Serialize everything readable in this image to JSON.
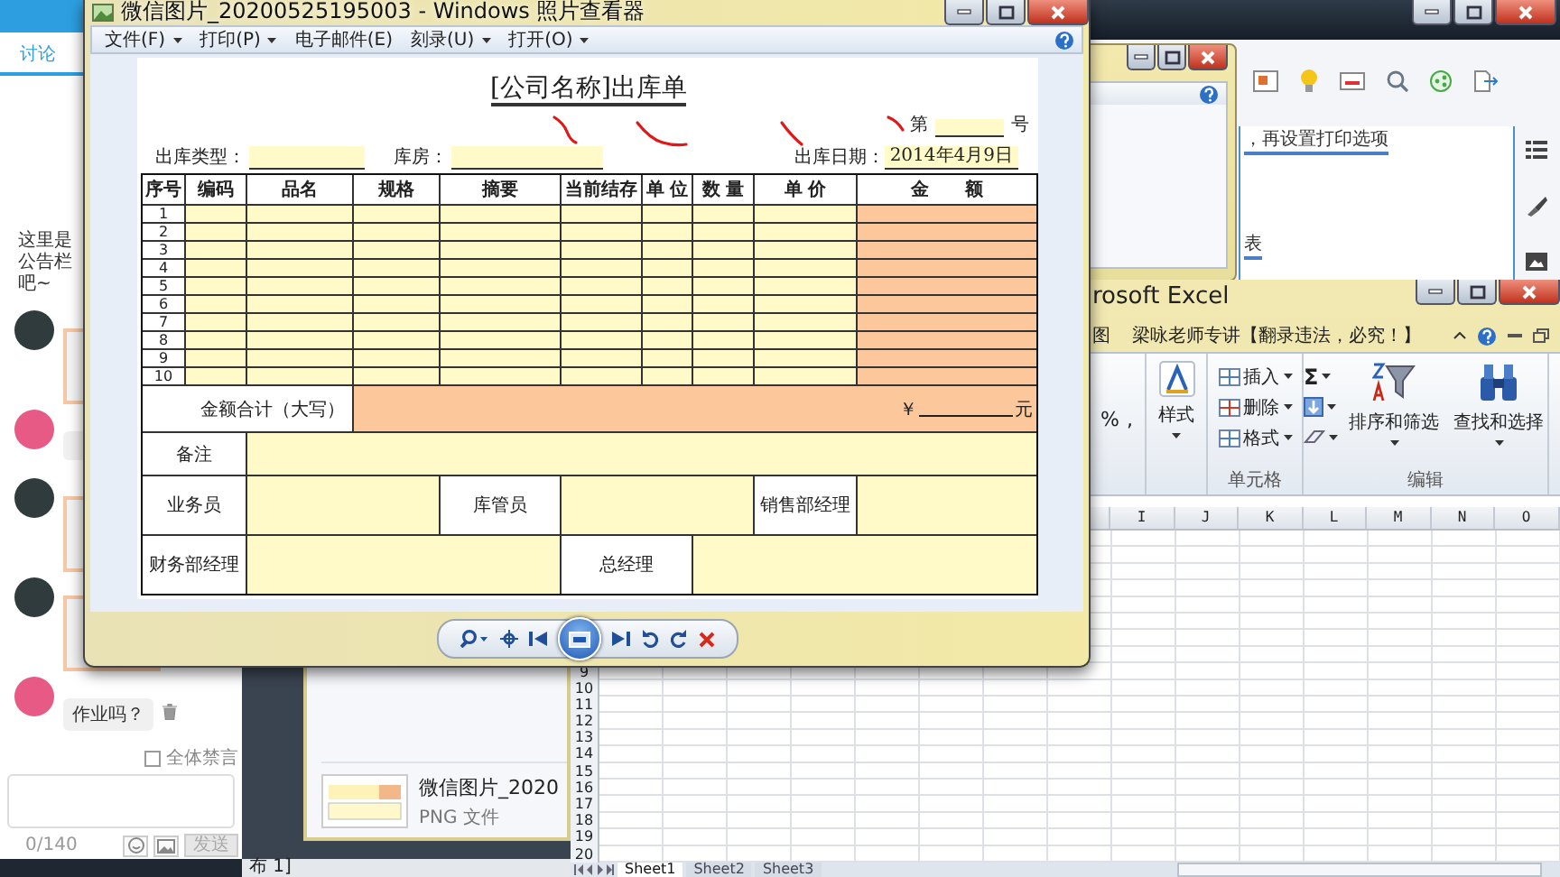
{
  "chat_panel": {
    "tab": {
      "label": "讨论",
      "selected": true
    },
    "notice": "这里是公告栏吧~",
    "messages": [
      {
        "kind": "image",
        "color": "#2f3b3c"
      },
      {
        "kind": "text",
        "color": "#e85a86"
      },
      {
        "kind": "image",
        "color": "#2f3b3c"
      },
      {
        "kind": "image",
        "color": "#2f3b3c"
      },
      {
        "kind": "text",
        "color": "#e85a86",
        "text": "作业吗？"
      }
    ],
    "mute_all": {
      "label": "全体禁言",
      "checked": false
    },
    "counter": "0/140",
    "send_button": {
      "label": "发送",
      "disabled": true
    }
  },
  "viewer": {
    "title": "微信图片_20200525195003 - Windows 照片查看器",
    "menu": [
      {
        "label": "文件(F)",
        "dropdown": true
      },
      {
        "label": "打印(P)",
        "dropdown": true
      },
      {
        "label": "电子邮件(E)",
        "dropdown": false
      },
      {
        "label": "刻录(U)",
        "dropdown": true
      },
      {
        "label": "打开(O)",
        "dropdown": true
      }
    ],
    "document": {
      "title": "[公司名称]出库单",
      "number": {
        "prefix": "第",
        "suffix": "号"
      },
      "fields": [
        {
          "label": "出库类型："
        },
        {
          "label": "库房："
        },
        {
          "label": "出库日期：",
          "value": "2014年4月9日"
        }
      ],
      "columns": [
        "序号",
        "编码",
        "品名",
        "规格",
        "摘要",
        "当前结存",
        "单 位",
        "数 量",
        "单 价",
        "金　　额"
      ],
      "rows": [
        "1",
        "2",
        "3",
        "4",
        "5",
        "6",
        "7",
        "8",
        "9",
        "10"
      ],
      "total": {
        "label": "金额合计（大写）",
        "currency": "￥",
        "unit": "元"
      },
      "remarks": "备注",
      "signatures": [
        [
          "业务员",
          "库管员",
          "销售部经理"
        ],
        [
          "财务部经理",
          "总经理"
        ]
      ]
    }
  },
  "excel": {
    "title": "rosoft Excel",
    "tabs": [
      "图",
      "梁咏老师专讲【翻录违法，必究！】"
    ],
    "ribbon": {
      "number_symbols": [
        "%",
        ","
      ],
      "styles_button": "样式",
      "cell_commands": [
        "插入",
        "删除",
        "格式"
      ],
      "cells_group": "单元格",
      "sum": "Σ",
      "sort_filter": "排序和筛选",
      "find_select": "查找和选择",
      "editing_group": "编辑"
    },
    "columns": [
      "I",
      "J",
      "K",
      "L",
      "M",
      "N",
      "O"
    ],
    "rows": [
      "9",
      "10",
      "11",
      "12",
      "13",
      "14",
      "15",
      "16",
      "17",
      "18",
      "19",
      "20"
    ],
    "sheets": [
      {
        "label": "Sheet1",
        "selected": true
      },
      {
        "label": "Sheet2",
        "selected": false
      },
      {
        "label": "Sheet3",
        "selected": false
      }
    ]
  },
  "back_window": {
    "lines": [
      "，再设置打印选项",
      "表"
    ]
  },
  "file_window": {
    "file_name": "微信图片_2020",
    "file_type": "PNG 文件"
  },
  "status_bar": {
    "text": "布 1]"
  }
}
